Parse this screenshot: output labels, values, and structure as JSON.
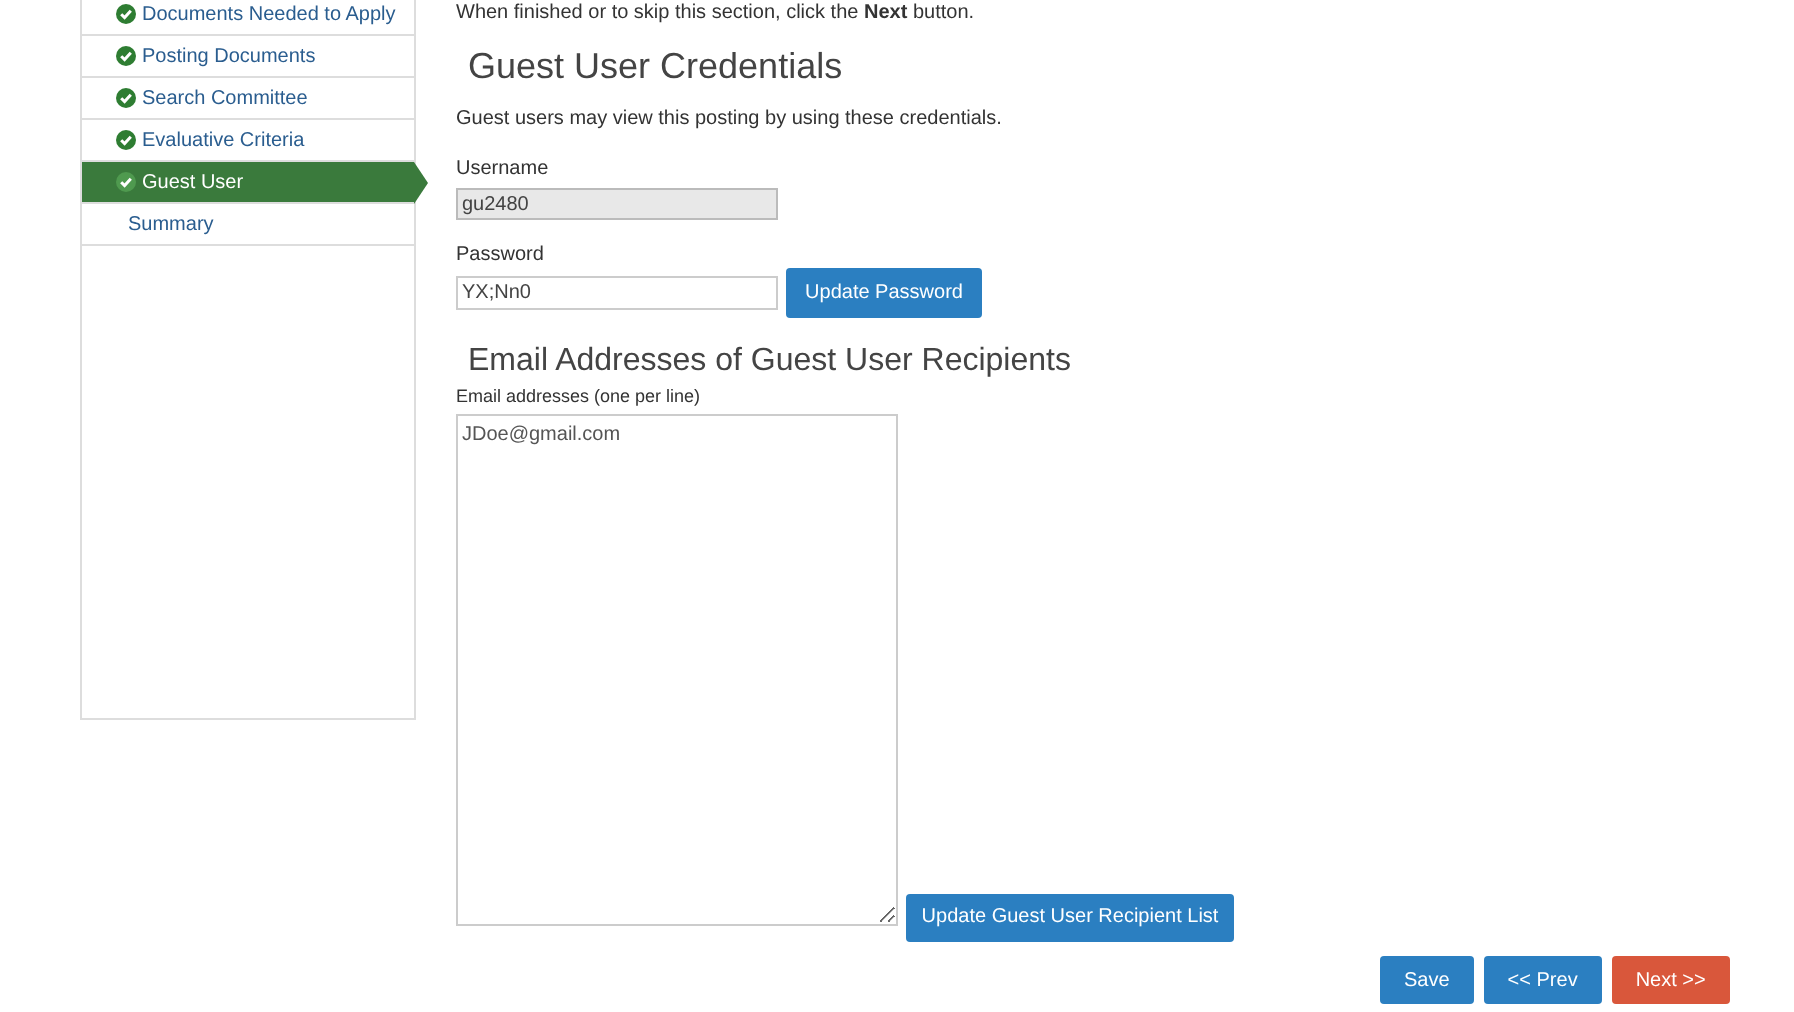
{
  "sidebar": {
    "items": [
      {
        "label": "Documents Needed to Apply",
        "complete": true,
        "selected": false
      },
      {
        "label": "Posting Documents",
        "complete": true,
        "selected": false
      },
      {
        "label": "Search Committee",
        "complete": true,
        "selected": false
      },
      {
        "label": "Evaluative Criteria",
        "complete": true,
        "selected": false
      },
      {
        "label": "Guest User",
        "complete": true,
        "selected": true
      },
      {
        "label": "Summary",
        "complete": false,
        "selected": false
      }
    ]
  },
  "intro": "When finished or to skip this section, click the **Next** button.",
  "credentials": {
    "title": "Guest User Credentials",
    "description": "Guest users may view this posting by using these credentials.",
    "username": {
      "label": "Username",
      "value": "gu2480",
      "disabled": true
    },
    "password": {
      "label": "Password",
      "value": "YX;Nn0"
    },
    "update_button": "Update Password"
  },
  "recipients": {
    "title": "Email Addresses of Guest User Recipients",
    "label": "Email addresses (one per line)",
    "value": "JDoe@gmail.com",
    "update_button": "Update Guest User Recipient List"
  },
  "footer_buttons": [
    {
      "label": "Save",
      "kind": "primary"
    },
    {
      "label": "<< Prev",
      "kind": "primary"
    },
    {
      "label": "Next >>",
      "kind": "danger"
    }
  ]
}
